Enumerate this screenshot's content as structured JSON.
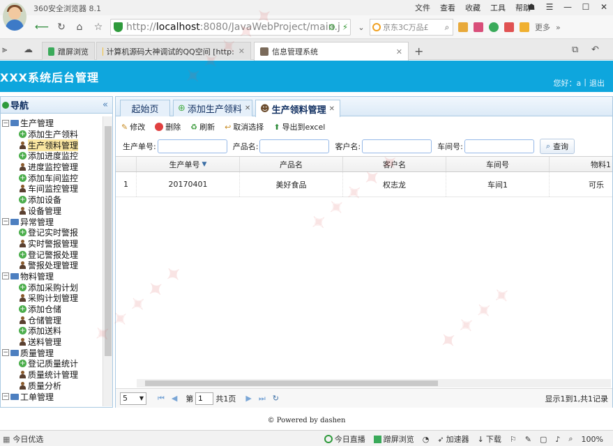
{
  "browser": {
    "title": "360安全浏览器 8.1",
    "menu": [
      "文件",
      "查看",
      "收藏",
      "工具",
      "帮助"
    ],
    "url_scheme": "http://",
    "url_host": "localhost",
    "url_rest": ":8080/JavaWebProject/main.j",
    "search_placeholder": "京东3C万品£",
    "more_label": "更多",
    "tabs": [
      {
        "label": "蹭屏浏览"
      },
      {
        "label": "计算机源码大神调试的QQ空间 [http:"
      },
      {
        "label": "信息管理系统"
      }
    ]
  },
  "app": {
    "title": "XXX系统后台管理",
    "greeting": "您好：a",
    "separator": "|",
    "logout": "退出"
  },
  "nav": {
    "title": "导航",
    "collapse": "«",
    "groups": [
      {
        "label": "生产管理",
        "items": [
          "添加生产领料",
          "生产领料管理",
          "添加进度监控",
          "进度监控管理",
          "添加车间监控",
          "车间监控管理",
          "添加设备",
          "设备管理"
        ]
      },
      {
        "label": "异常管理",
        "items": [
          "登记实时警报",
          "实时警报管理",
          "登记警报处理",
          "警报处理管理"
        ]
      },
      {
        "label": "物料管理",
        "items": [
          "添加采购计划",
          "采购计划管理",
          "添加仓储",
          "仓储管理",
          "添加送料",
          "送料管理"
        ]
      },
      {
        "label": "质量管理",
        "items": [
          "登记质量统计",
          "质量统计管理",
          "质量分析"
        ]
      },
      {
        "label": "工单管理",
        "items": []
      }
    ]
  },
  "panel_tabs": [
    {
      "label": "起始页"
    },
    {
      "label": "添加生产领料"
    },
    {
      "label": "生产领料管理"
    }
  ],
  "toolbar": {
    "edit": "修改",
    "delete": "删除",
    "refresh": "刷新",
    "cancel_select": "取消选择",
    "export": "导出到excel"
  },
  "filters": {
    "order_label": "生产单号:",
    "product_label": "产品名:",
    "customer_label": "客户名:",
    "workshop_label": "车间号:",
    "query": "查询"
  },
  "grid": {
    "columns": [
      "生产单号",
      "产品名",
      "客户名",
      "车间号",
      "物料1"
    ],
    "rows": [
      {
        "index": "1",
        "order": "20170401",
        "product": "美好食品",
        "customer": "权志龙",
        "workshop": "车间1",
        "material": "可乐"
      }
    ]
  },
  "pager": {
    "page_size": "5",
    "page_prefix": "第",
    "page_value": "1",
    "page_suffix": "共1页",
    "info": "显示1到1,共1记录"
  },
  "footer": "© Powered by dashen",
  "statusbar": {
    "left": "今日优选",
    "live": "今日直播",
    "screen": "蹭屏浏览",
    "accelerator": "加速器",
    "download": "下载",
    "zoom": "100%"
  }
}
